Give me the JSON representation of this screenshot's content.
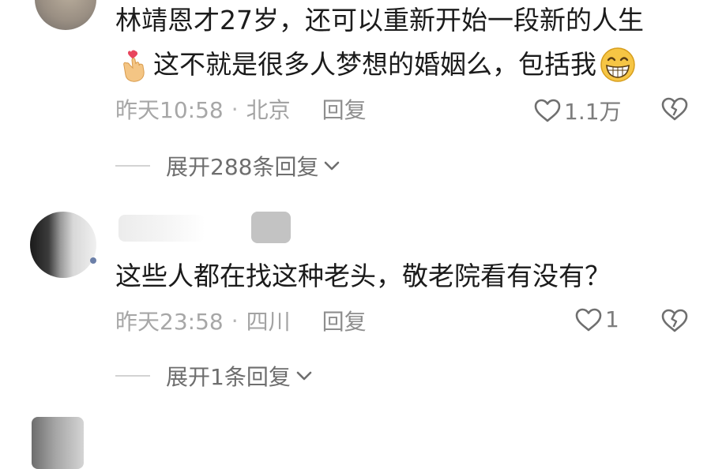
{
  "comments": [
    {
      "line1": "林靖恩才27岁，还可以重新开始一段新的人生",
      "line2": "这不就是很多人梦想的婚姻么，包括我",
      "time": "昨天10:58",
      "location": "北京",
      "reply_label": "回复",
      "like_count": "1.1万",
      "expand_label": "展开288条回复",
      "emojis": [
        "finger-heart-icon",
        "grinning-face-icon"
      ]
    },
    {
      "line1": "这些人都在找这种老头，敬老院看有没有？",
      "time": "昨天23:58",
      "location": "四川",
      "reply_label": "回复",
      "like_count": "1",
      "expand_label": "展开1条回复"
    }
  ],
  "separator": "·",
  "colors": {
    "text_primary": "#1b1b1b",
    "text_meta": "#a3a3a3",
    "icon_gray": "#7d7d7d"
  }
}
